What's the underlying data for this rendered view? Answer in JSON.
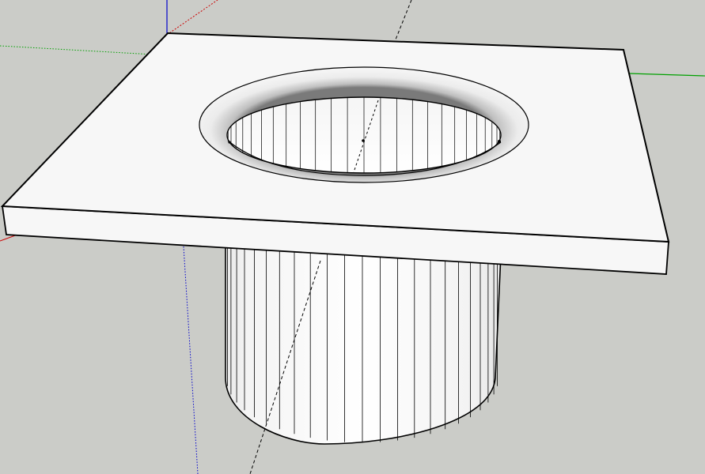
{
  "app": {
    "name": "",
    "view": "3d-modeling-viewport"
  },
  "viewport": {
    "background_color": "#cbccc8",
    "model_face_color": "#f7f7f7",
    "model_edge_color": "#000000",
    "axes": {
      "red_axis_color": "#cc0000",
      "green_axis_color": "#00a000",
      "blue_axis_color": "#0000cc"
    },
    "guide_line_color": "#000000",
    "model": {
      "description_icon": "cube-icon"
    }
  }
}
